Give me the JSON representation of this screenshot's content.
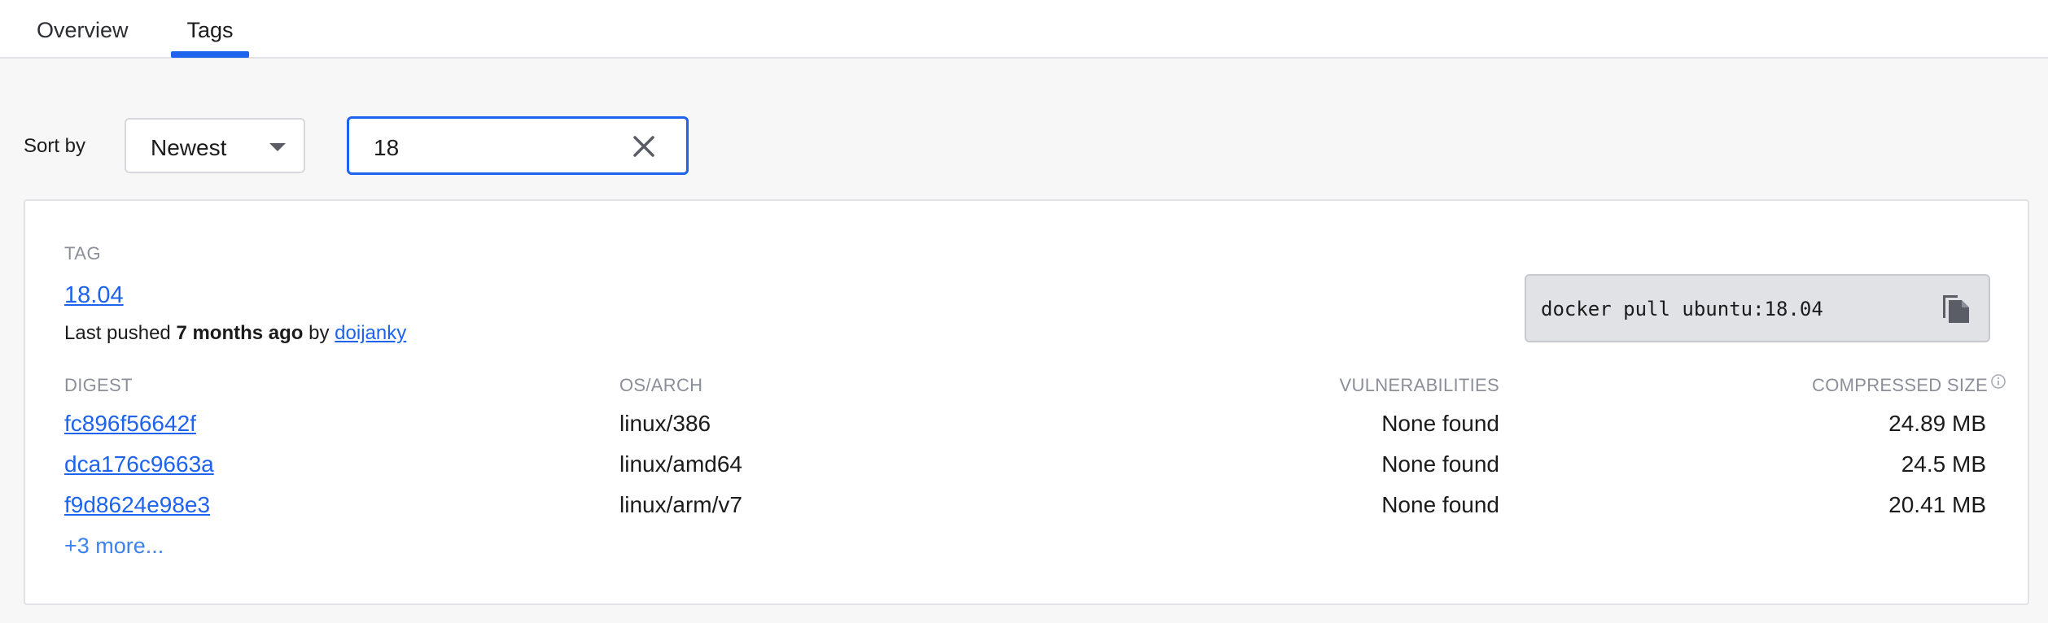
{
  "tabs": [
    {
      "label": "Overview",
      "active": false
    },
    {
      "label": "Tags",
      "active": true
    }
  ],
  "toolbar": {
    "sort_label": "Sort by",
    "sort_value": "Newest",
    "search_value": "18"
  },
  "tag_card": {
    "section_label": "TAG",
    "tag_name": "18.04",
    "pushed_prefix": "Last pushed",
    "pushed_time": "7 months ago",
    "pushed_by_word": "by",
    "pushed_by_user": "doijanky",
    "pull_command": "docker pull ubuntu:18.04",
    "columns": {
      "digest": "DIGEST",
      "os_arch": "OS/ARCH",
      "vulnerabilities": "VULNERABILITIES",
      "compressed_size": "COMPRESSED SIZE"
    },
    "rows": [
      {
        "digest": "fc896f56642f",
        "os_arch": "linux/386",
        "vulnerabilities": "None found",
        "size": "24.89 MB"
      },
      {
        "digest": "dca176c9663a",
        "os_arch": "linux/amd64",
        "vulnerabilities": "None found",
        "size": "24.5 MB"
      },
      {
        "digest": "f9d8624e98e3",
        "os_arch": "linux/arm/v7",
        "vulnerabilities": "None found",
        "size": "20.41 MB"
      }
    ],
    "more_link": "+3 more..."
  },
  "icons": {
    "sort_caret": "caret-down-icon",
    "clear": "close-icon",
    "copy": "copy-icon",
    "info": "info-icon"
  },
  "colors": {
    "accent": "#1d63ed",
    "link": "#1d63ed",
    "muted": "#8b8f99",
    "background": "#f7f7f7",
    "card": "#ffffff",
    "pull_box": "#e1e2e6"
  }
}
